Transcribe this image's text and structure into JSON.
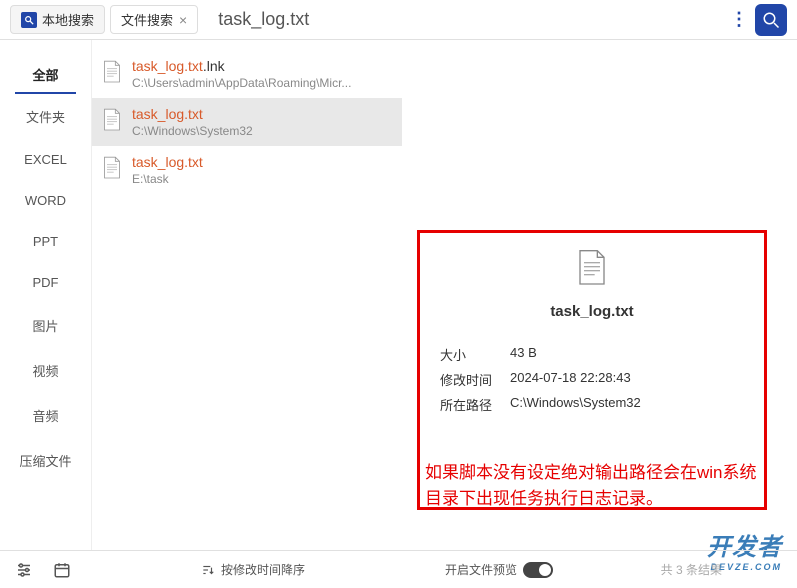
{
  "header": {
    "tab1": "本地搜索",
    "tab2": "文件搜索",
    "title": "task_log.txt"
  },
  "sidebar": {
    "items": [
      "全部",
      "文件夹",
      "EXCEL",
      "WORD",
      "PPT",
      "PDF",
      "图片",
      "视频",
      "音频",
      "压缩文件"
    ]
  },
  "results": [
    {
      "name": "task_log.txt",
      "ext": ".lnk",
      "path": "C:\\Users\\admin\\AppData\\Roaming\\Micr..."
    },
    {
      "name": "task_log.txt",
      "ext": "",
      "path": "C:\\Windows\\System32"
    },
    {
      "name": "task_log.txt",
      "ext": "",
      "path": "E:\\task"
    }
  ],
  "preview": {
    "name": "task_log.txt",
    "size_label": "大小",
    "size_val": "43 B",
    "mtime_label": "修改时间",
    "mtime_val": "2024-07-18 22:28:43",
    "path_label": "所在路径",
    "path_val": "C:\\Windows\\System32"
  },
  "annotation": "如果脚本没有设定绝对输出路径会在win系统目录下出现任务执行日志记录。",
  "footer": {
    "sort": "按修改时间降序",
    "preview_toggle": "开启文件预览",
    "count": "共 3 条结果"
  },
  "watermark": {
    "main": "开发者",
    "sub": "DEVZE.COM"
  }
}
